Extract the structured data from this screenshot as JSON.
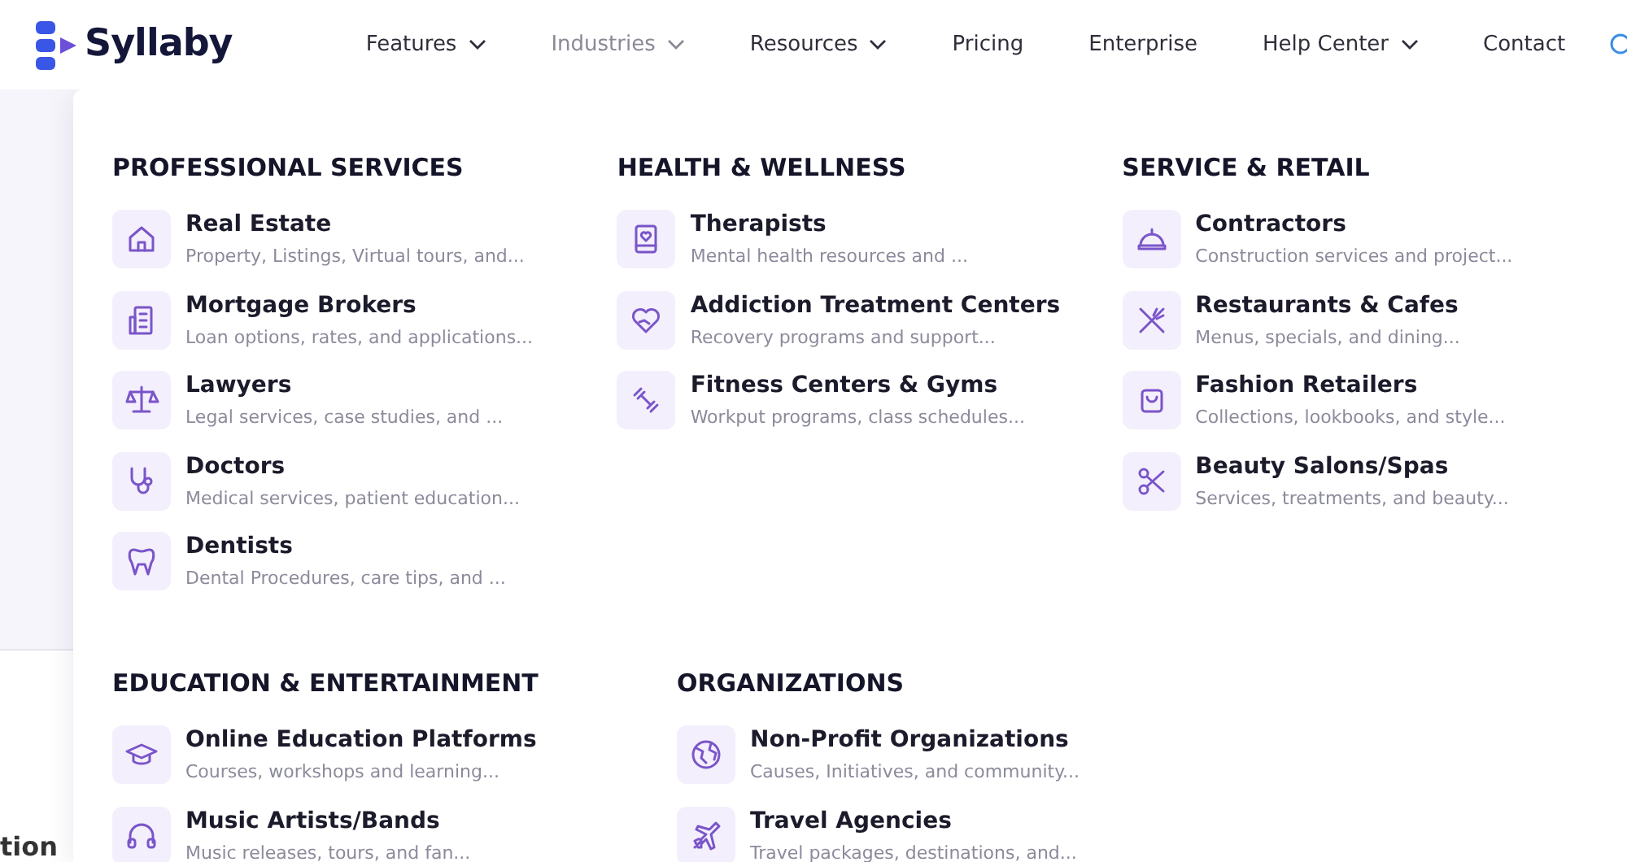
{
  "logo": {
    "text": "Syllaby"
  },
  "nav": {
    "items": [
      {
        "label": "Features",
        "has_dropdown": true,
        "selected": false
      },
      {
        "label": "Industries",
        "has_dropdown": true,
        "selected": true
      },
      {
        "label": "Resources",
        "has_dropdown": true,
        "selected": false
      },
      {
        "label": "Pricing",
        "has_dropdown": false,
        "selected": false
      },
      {
        "label": "Enterprise",
        "has_dropdown": false,
        "selected": false
      },
      {
        "label": "Help Center",
        "has_dropdown": true,
        "selected": false
      },
      {
        "label": "Contact",
        "has_dropdown": false,
        "selected": false
      }
    ]
  },
  "background": {
    "heading_fragment": "tion"
  },
  "dropdown": {
    "rows": [
      {
        "sections": [
          {
            "title": "PROFESSIONAL SERVICES",
            "items": [
              {
                "title": "Real Estate",
                "description": "Property, Listings, Virtual tours, and..."
              },
              {
                "title": "Mortgage Brokers",
                "description": "Loan options, rates, and applications..."
              },
              {
                "title": "Lawyers",
                "description": "Legal services, case studies, and ..."
              },
              {
                "title": "Doctors",
                "description": "Medical services, patient education..."
              },
              {
                "title": "Dentists",
                "description": "Dental Procedures, care tips, and ..."
              }
            ]
          },
          {
            "title": "HEALTH & WELLNESS",
            "items": [
              {
                "title": "Therapists",
                "description": "Mental health resources and ..."
              },
              {
                "title": "Addiction Treatment Centers",
                "description": "Recovery programs and support..."
              },
              {
                "title": "Fitness Centers & Gyms",
                "description": "Workput programs, class schedules..."
              }
            ]
          },
          {
            "title": "SERVICE & RETAIL",
            "items": [
              {
                "title": "Contractors",
                "description": "Construction services and project..."
              },
              {
                "title": "Restaurants & Cafes",
                "description": "Menus, specials, and dining..."
              },
              {
                "title": "Fashion Retailers",
                "description": "Collections, lookbooks, and style..."
              },
              {
                "title": "Beauty Salons/Spas",
                "description": "Services, treatments, and beauty..."
              }
            ]
          }
        ]
      },
      {
        "sections": [
          {
            "title": "EDUCATION & ENTERTAINMENT",
            "items": [
              {
                "title": "Online Education Platforms",
                "description": "Courses, workshops and learning..."
              },
              {
                "title": "Music Artists/Bands",
                "description": "Music releases, tours, and fan..."
              }
            ]
          },
          {
            "title": "ORGANIZATIONS",
            "items": [
              {
                "title": "Non-Profit Organizations",
                "description": "Causes, Initiatives, and community..."
              },
              {
                "title": "Travel Agencies",
                "description": "Travel packages, destinations, and..."
              }
            ]
          }
        ]
      }
    ]
  }
}
